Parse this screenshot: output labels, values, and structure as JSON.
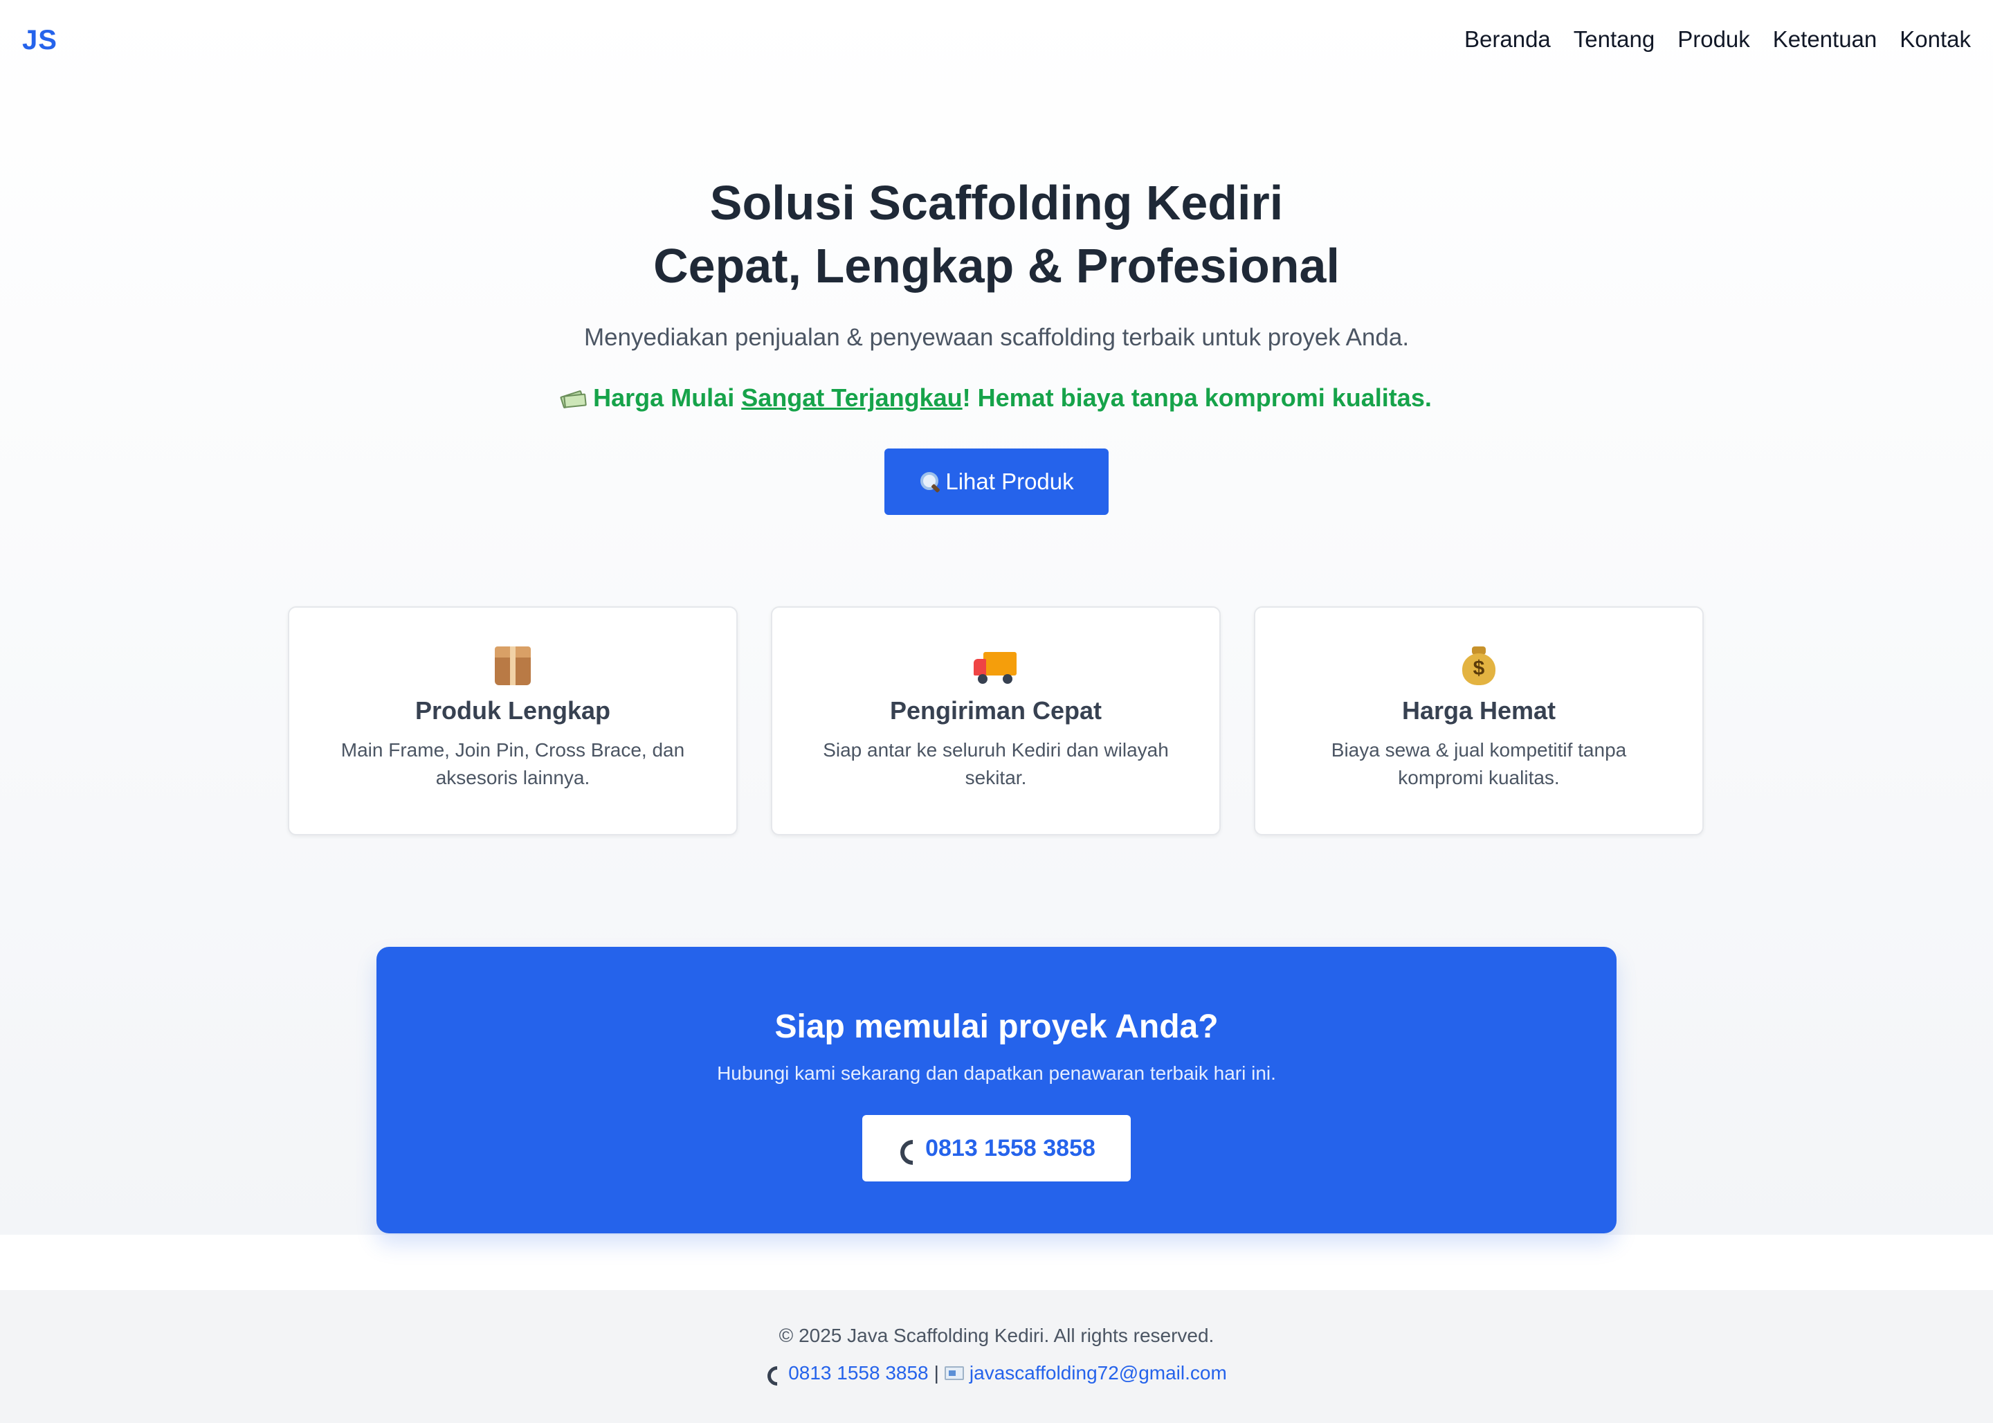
{
  "header": {
    "logo": "JS",
    "nav": [
      "Beranda",
      "Tentang",
      "Produk",
      "Ketentuan",
      "Kontak"
    ]
  },
  "hero": {
    "title_line1": "Solusi Scaffolding Kediri",
    "title_line2": "Cepat, Lengkap & Profesional",
    "subtitle": "Menyediakan penjualan & penyewaan scaffolding terbaik untuk proyek Anda.",
    "promo_prefix": "Harga Mulai ",
    "promo_highlight": "Sangat Terjangkau",
    "promo_suffix": "! Hemat biaya tanpa kompromi kualitas.",
    "promo_icon": "money-with-wings-icon",
    "cta_label": "Lihat Produk",
    "cta_icon": "magnifier-icon"
  },
  "features": [
    {
      "icon": "package-icon",
      "title": "Produk Lengkap",
      "text": "Main Frame, Join Pin, Cross Brace, dan aksesoris lainnya."
    },
    {
      "icon": "delivery-truck-icon",
      "title": "Pengiriman Cepat",
      "text": "Siap antar ke seluruh Kediri dan wilayah sekitar."
    },
    {
      "icon": "money-bag-icon",
      "title": "Harga Hemat",
      "text": "Biaya sewa & jual kompetitif tanpa kompromi kualitas."
    }
  ],
  "banner": {
    "title": "Siap memulai proyek Anda?",
    "text": "Hubungi kami sekarang dan dapatkan penawaran terbaik hari ini.",
    "phone_label": "0813 1558 3858",
    "phone_icon": "telephone-icon"
  },
  "footer": {
    "copyright": "© 2025 Java Scaffolding Kediri. All rights reserved.",
    "phone": "0813 1558 3858",
    "separator": "|",
    "email": "javascaffolding72@gmail.com"
  },
  "colors": {
    "primary": "#2563eb",
    "promo_green": "#16a34a",
    "heading": "#1f2937",
    "footer_bg": "#f3f4f6"
  }
}
